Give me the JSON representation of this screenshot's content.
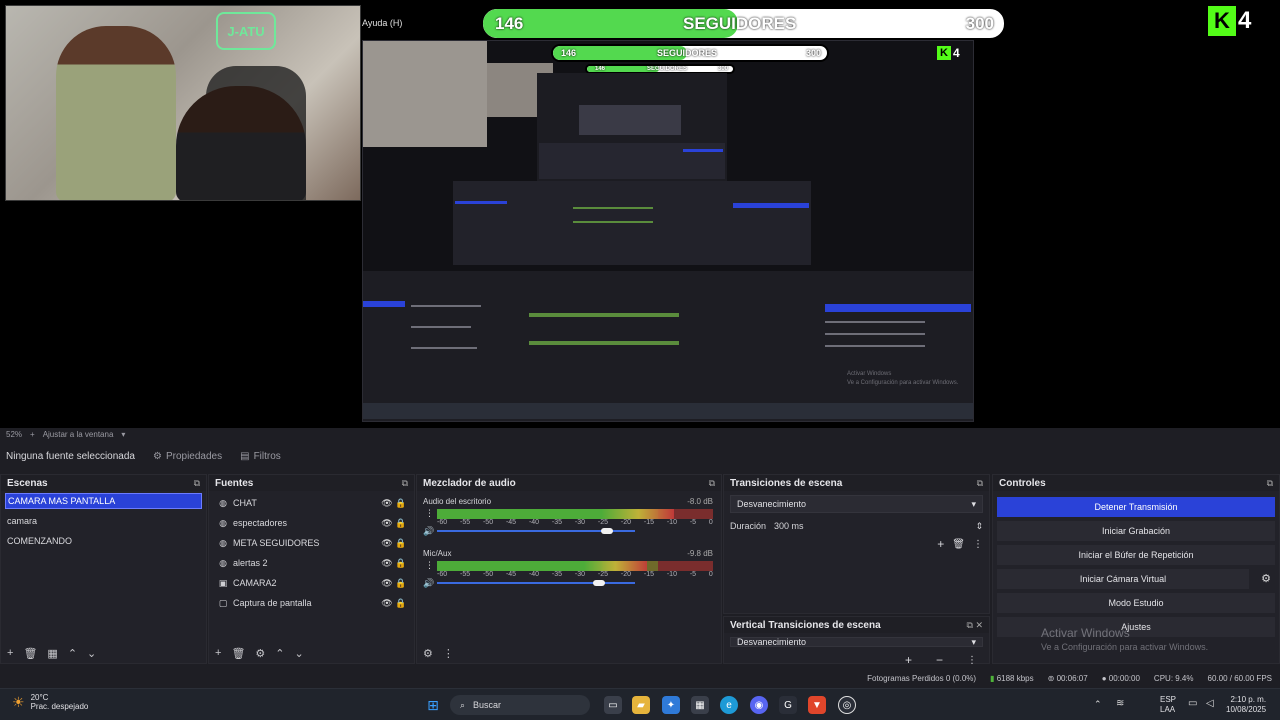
{
  "preview": {
    "help_menu": "Ayuda (H)",
    "cam_sign": "J-ATU",
    "follow_main": {
      "current": "146",
      "label": "SEGUIDORES",
      "goal": "300",
      "progress": 0.49
    },
    "follow_nested": {
      "current": "146",
      "label": "SEGUIDORES",
      "goal": "300"
    },
    "follow_nested2": {
      "current": "146",
      "label": "SEGUIDORES",
      "goal": "300"
    },
    "kick_count": "4",
    "nested_activate": "Activar Windows",
    "nested_activate_sub": "Ve a Configuración para activar Windows."
  },
  "zoom": {
    "value": "52%",
    "fit": "Ajustar a la ventana"
  },
  "context": {
    "no_source": "Ninguna fuente seleccionada",
    "properties": "Propiedades",
    "filters": "Filtros"
  },
  "scenes": {
    "title": "Escenas",
    "items": [
      "CAMARA MAS PANTALLA",
      "camara",
      "COMENZANDO"
    ]
  },
  "sources": {
    "title": "Fuentes",
    "items": [
      {
        "name": "CHAT",
        "icon": "browser"
      },
      {
        "name": "espectadores",
        "icon": "browser"
      },
      {
        "name": "META SEGUIDORES",
        "icon": "browser"
      },
      {
        "name": "alertas 2",
        "icon": "browser"
      },
      {
        "name": "CAMARA2",
        "icon": "camera"
      },
      {
        "name": "Captura de pantalla",
        "icon": "monitor"
      }
    ]
  },
  "mixer": {
    "title": "Mezclador de audio",
    "ticks": [
      "-60",
      "-55",
      "-50",
      "-45",
      "-40",
      "-35",
      "-30",
      "-25",
      "-20",
      "-15",
      "-10",
      "-5",
      "0"
    ],
    "channels": [
      {
        "name": "Audio del escritorio",
        "db": "-8.0 dB",
        "level": 0.86,
        "volume": 0.86
      },
      {
        "name": "Mic/Aux",
        "db": "-9.8 dB",
        "level": 0.76,
        "volume": 0.82
      }
    ]
  },
  "transitions": {
    "title": "Transiciones de escena",
    "selected": "Desvanecimiento",
    "duration_label": "Duración",
    "duration_value": "300 ms",
    "vertical_title": "Vertical Transiciones de escena",
    "vertical_selected": "Desvanecimiento"
  },
  "controls": {
    "title": "Controles",
    "buttons": [
      "Detener Transmisión",
      "Iniciar Grabación",
      "Iniciar el Búfer de Repetición",
      "Iniciar Cámara Virtual",
      "Modo Estudio",
      "Ajustes"
    ]
  },
  "watermark": {
    "title": "Activar Windows",
    "subtitle": "Ve a Configuración para activar Windows."
  },
  "status": {
    "dropped": "Fotogramas Perdidos 0 (0.0%)",
    "bitrate": "6188 kbps",
    "time_live": "00:06:07",
    "time_rec": "00:00:00",
    "cpu": "CPU: 9.4%",
    "fps": "60.00 / 60.00 FPS"
  },
  "taskbar": {
    "weather_temp": "20°C",
    "weather_desc": "Prac. despejado",
    "search": "Buscar",
    "lang1": "ESP",
    "lang2": "LAA",
    "time": "2:10 p. m.",
    "date": "10/08/2025"
  },
  "colors": {
    "accent": "#2a42d8",
    "kick_green": "#53fc18",
    "meter_green": "#4fb33a"
  }
}
